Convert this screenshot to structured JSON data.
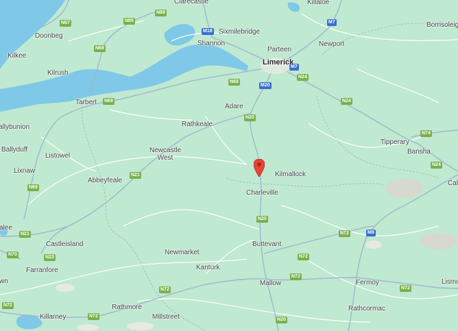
{
  "map": {
    "type": "road-map",
    "colors": {
      "land": "#bfe9d0",
      "water": "#7fc8e8",
      "road_major": "#9fb6cf",
      "road_minor": "#ffffff",
      "county_border": "#a6c2b3",
      "hill_shade": "#d7d9cf",
      "pin": "#ea4335",
      "national_shield": "#7ab04b",
      "motorway_shield": "#3a6fcf"
    },
    "places": [
      {
        "id": "clarecastle",
        "label": "Clarecastle"
      },
      {
        "id": "killaloe",
        "label": "Killaloe"
      },
      {
        "id": "borrisoleigh",
        "label": "Borrisoleigh"
      },
      {
        "id": "doonbeg",
        "label": "Doonbeg"
      },
      {
        "id": "sixmilebridge",
        "label": "Sixmilebridge"
      },
      {
        "id": "shannon",
        "label": "Shannon"
      },
      {
        "id": "kilkee",
        "label": "Kilkee"
      },
      {
        "id": "parteen",
        "label": "Parteen"
      },
      {
        "id": "newport",
        "label": "Newport"
      },
      {
        "id": "limerick",
        "label": "Limerick"
      },
      {
        "id": "kilrush",
        "label": "Kilrush"
      },
      {
        "id": "tarbert",
        "label": "Tarbert"
      },
      {
        "id": "adare",
        "label": "Adare"
      },
      {
        "id": "ballybunion",
        "label": "allybunion"
      },
      {
        "id": "rathkeale",
        "label": "Rathkeale"
      },
      {
        "id": "ballyduff",
        "label": "Ballyduff"
      },
      {
        "id": "listowel",
        "label": "Listowel"
      },
      {
        "id": "newcastle_west",
        "label": "Newcastle West"
      },
      {
        "id": "tipperary",
        "label": "Tipperary"
      },
      {
        "id": "bansha",
        "label": "Bansha"
      },
      {
        "id": "lixnaw",
        "label": "Lixnaw"
      },
      {
        "id": "kilmallock",
        "label": "Kilmallock"
      },
      {
        "id": "abbeyfeale",
        "label": "Abbeyfeale"
      },
      {
        "id": "cahir",
        "label": "Cahi"
      },
      {
        "id": "charleville",
        "label": "Charleville"
      },
      {
        "id": "tralee",
        "label": "alee"
      },
      {
        "id": "castleisland",
        "label": "Castleisland"
      },
      {
        "id": "buttevant",
        "label": "Buttevant"
      },
      {
        "id": "newmarket",
        "label": "Newmarket"
      },
      {
        "id": "farranfore",
        "label": "Farranfore"
      },
      {
        "id": "kanturk",
        "label": "Kanturk"
      },
      {
        "id": "fermoy",
        "label": "Fermoy"
      },
      {
        "id": "lismore",
        "label": "Lismo"
      },
      {
        "id": "town_edge",
        "label": "wn"
      },
      {
        "id": "mallow",
        "label": "Mallow"
      },
      {
        "id": "rathmore",
        "label": "Rathmore"
      },
      {
        "id": "rathcormac",
        "label": "Rathcormac"
      },
      {
        "id": "killarney",
        "label": "Killarney"
      },
      {
        "id": "millstreet",
        "label": "Millstreet"
      }
    ],
    "shields": [
      {
        "id": "n68_top",
        "label": "N68",
        "kind": "national"
      },
      {
        "id": "n67",
        "label": "N67",
        "kind": "national"
      },
      {
        "id": "n85",
        "label": "N85",
        "kind": "national"
      },
      {
        "id": "m18",
        "label": "M18",
        "kind": "motorway"
      },
      {
        "id": "m7",
        "label": "M7",
        "kind": "motorway"
      },
      {
        "id": "n68",
        "label": "N68",
        "kind": "national"
      },
      {
        "id": "m7b",
        "label": "M7",
        "kind": "motorway"
      },
      {
        "id": "n24a",
        "label": "N24",
        "kind": "national"
      },
      {
        "id": "n69a",
        "label": "N69",
        "kind": "national"
      },
      {
        "id": "m20",
        "label": "M20",
        "kind": "motorway"
      },
      {
        "id": "n69b",
        "label": "N69",
        "kind": "national"
      },
      {
        "id": "n24b",
        "label": "N24",
        "kind": "national"
      },
      {
        "id": "n20a",
        "label": "N20",
        "kind": "national"
      },
      {
        "id": "n74",
        "label": "N74",
        "kind": "national"
      },
      {
        "id": "n24c",
        "label": "N24",
        "kind": "national"
      },
      {
        "id": "n21a",
        "label": "N21",
        "kind": "national"
      },
      {
        "id": "n69c",
        "label": "N69",
        "kind": "national"
      },
      {
        "id": "n20b",
        "label": "N20",
        "kind": "national"
      },
      {
        "id": "m8",
        "label": "M8",
        "kind": "motorway"
      },
      {
        "id": "n21b",
        "label": "N21",
        "kind": "national"
      },
      {
        "id": "n72a",
        "label": "N72",
        "kind": "national"
      },
      {
        "id": "n70",
        "label": "N70",
        "kind": "national"
      },
      {
        "id": "n23",
        "label": "N23",
        "kind": "national"
      },
      {
        "id": "n72b",
        "label": "N72",
        "kind": "national"
      },
      {
        "id": "n72c",
        "label": "N72",
        "kind": "national"
      },
      {
        "id": "n72d",
        "label": "N72",
        "kind": "national"
      },
      {
        "id": "n72e",
        "label": "N72",
        "kind": "national"
      },
      {
        "id": "n72f",
        "label": "N72",
        "kind": "national"
      },
      {
        "id": "n72g",
        "label": "N72",
        "kind": "national"
      },
      {
        "id": "n20c",
        "label": "N20",
        "kind": "national"
      }
    ],
    "marker": {
      "icon": "map-pin-icon",
      "near": "Charleville"
    }
  }
}
